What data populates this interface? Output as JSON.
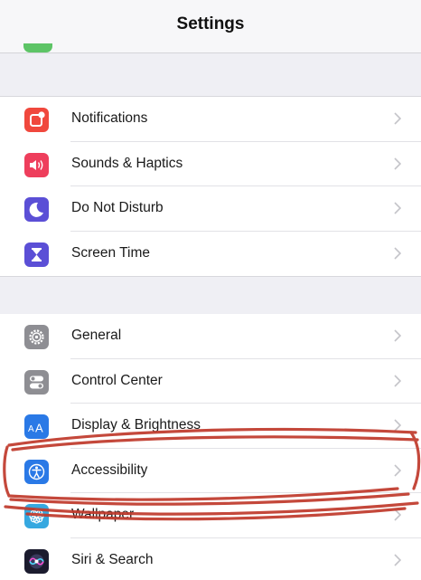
{
  "nav": {
    "title": "Settings"
  },
  "groups": [
    {
      "rows": [
        {
          "label": "Notifications",
          "icon": "notifications-icon",
          "color": "#f0483d"
        },
        {
          "label": "Sounds & Haptics",
          "icon": "speaker-icon",
          "color": "#ee3e5c"
        },
        {
          "label": "Do Not Disturb",
          "icon": "moon-icon",
          "color": "#5b4fd6"
        },
        {
          "label": "Screen Time",
          "icon": "hourglass-icon",
          "color": "#5b4fd6"
        }
      ]
    },
    {
      "rows": [
        {
          "label": "General",
          "icon": "gear-icon",
          "color": "#8e8e93"
        },
        {
          "label": "Control Center",
          "icon": "toggles-icon",
          "color": "#8e8e93"
        },
        {
          "label": "Display & Brightness",
          "icon": "text-size-icon",
          "color": "#2a79e6"
        },
        {
          "label": "Accessibility",
          "icon": "accessibility-icon",
          "color": "#2a79e6"
        },
        {
          "label": "Wallpaper",
          "icon": "flower-icon",
          "color": "#36a8e0"
        },
        {
          "label": "Siri & Search",
          "icon": "siri-icon",
          "color": "#1b1b2e"
        }
      ]
    }
  ],
  "annotation": {
    "color": "#c0392b"
  }
}
